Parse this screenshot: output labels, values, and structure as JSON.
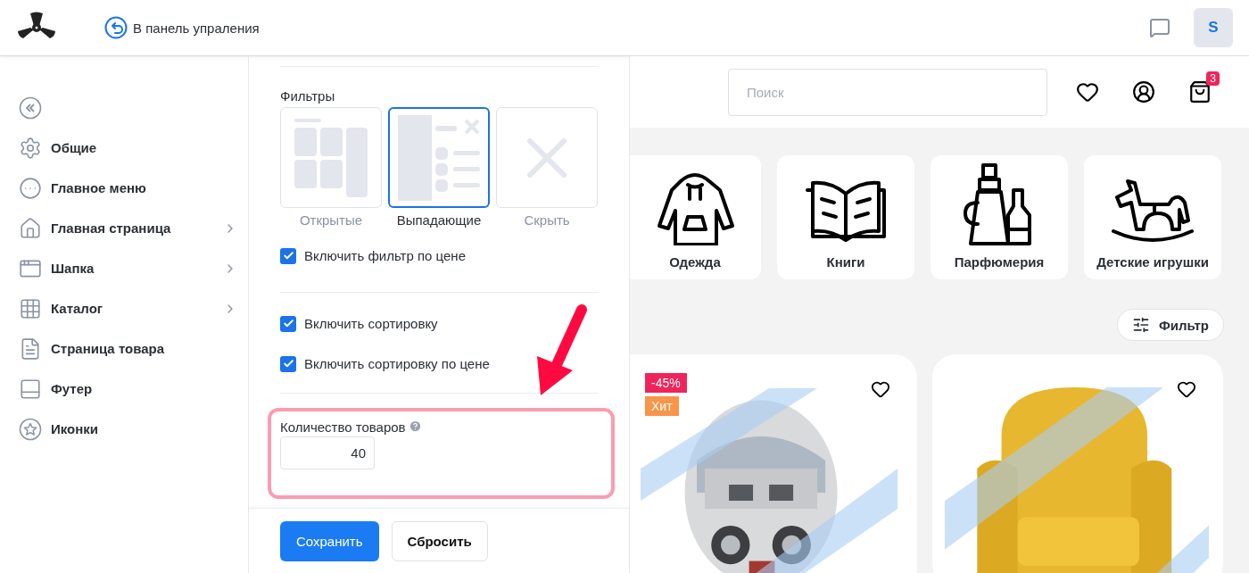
{
  "header": {
    "back_link": "В панель упраления",
    "avatar": "S"
  },
  "sidebar": {
    "items": [
      {
        "label": "Общие",
        "expandable": false
      },
      {
        "label": "Главное меню",
        "expandable": false
      },
      {
        "label": "Главная страница",
        "expandable": true
      },
      {
        "label": "Шапка",
        "expandable": true
      },
      {
        "label": "Каталог",
        "expandable": true
      },
      {
        "label": "Страница товара",
        "expandable": false
      },
      {
        "label": "Футер",
        "expandable": false
      },
      {
        "label": "Иконки",
        "expandable": false
      }
    ]
  },
  "settings": {
    "filters": {
      "title": "Фильтры",
      "options": [
        {
          "label": "Открытые",
          "selected": false
        },
        {
          "label": "Выпадающие",
          "selected": true
        },
        {
          "label": "Скрыть",
          "selected": false
        }
      ]
    },
    "checkbox_groups": [
      [
        {
          "label": "Включить фильтр по цене",
          "checked": true
        }
      ],
      [
        {
          "label": "Включить сортировку",
          "checked": true
        },
        {
          "label": "Включить сортировку по цене",
          "checked": true
        }
      ]
    ],
    "product_count": {
      "label": "Количество товаров",
      "value": "40"
    },
    "buttons": {
      "save": "Сохранить",
      "reset": "Сбросить"
    }
  },
  "preview": {
    "search": {
      "placeholder": "Поиск"
    },
    "cart_count": "3",
    "categories": [
      {
        "label": "Одежда"
      },
      {
        "label": "Книги"
      },
      {
        "label": "Парфюмерия"
      },
      {
        "label": "Детские игрушки"
      }
    ],
    "filter_button": "Фильтр",
    "products": [
      {
        "kind": "picture",
        "badges": [
          {
            "text": "-45%",
            "color": "#f0245c"
          },
          {
            "text": "Хит",
            "color": "#f7954a"
          }
        ]
      },
      {
        "kind": "picture"
      }
    ]
  }
}
